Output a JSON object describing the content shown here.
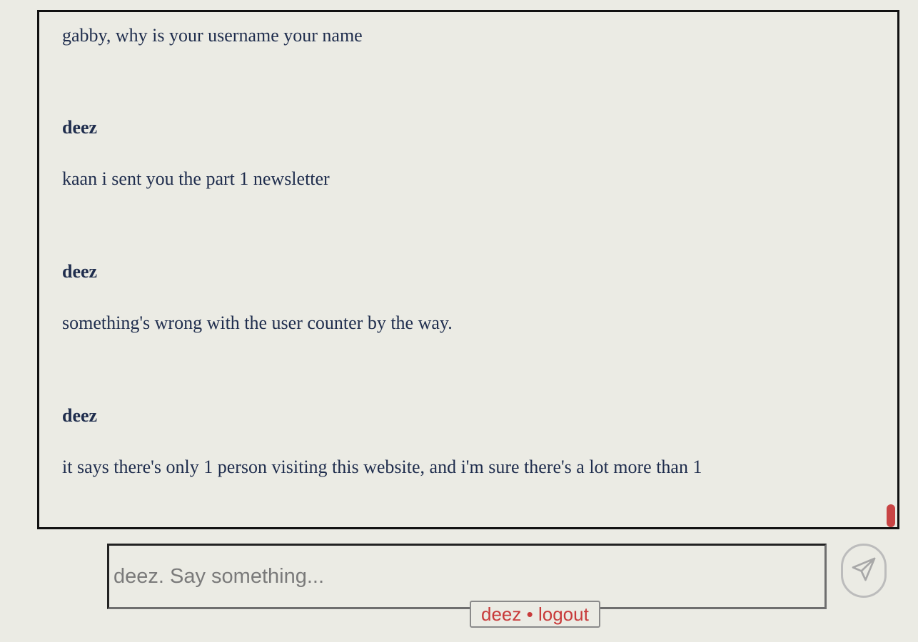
{
  "chat": {
    "messages": [
      {
        "author": "",
        "text": "gabby, why is your username your name"
      },
      {
        "author": "deez",
        "text": "kaan i sent you the part 1 newsletter"
      },
      {
        "author": "deez",
        "text": "something's wrong with the user counter by the way."
      },
      {
        "author": "deez",
        "text": "it says there's only 1 person visiting this website, and i'm sure there's a lot more than 1"
      }
    ]
  },
  "composer": {
    "placeholder": "deez. Say something...",
    "value": ""
  },
  "send_button": {
    "icon": "paper-plane-icon"
  },
  "user_bar": {
    "username": "deez",
    "separator": "•",
    "logout_label": "logout"
  },
  "colors": {
    "background": "#ebebe4",
    "text": "#1f2d4d",
    "accent": "#c83a3a",
    "scroll_thumb": "#c84444"
  }
}
